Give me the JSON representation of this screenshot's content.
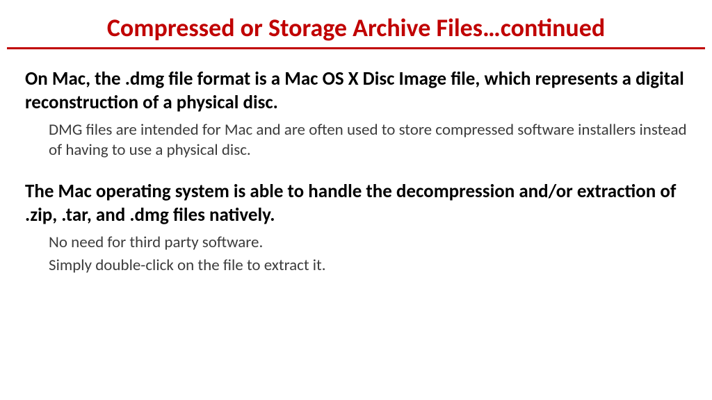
{
  "title": "Compressed or Storage Archive Files…continued",
  "blocks": [
    {
      "lead": "On Mac, the .dmg file format is a Mac OS X Disc Image file, which represents a digital reconstruction of a physical disc.",
      "subs": [
        "DMG files are intended for Mac and are often used to store compressed software installers instead of having to use a physical disc."
      ]
    },
    {
      "lead": "The Mac operating system is able to handle the decompression and/or extraction of .zip, .tar, and .dmg files natively.",
      "subs": [
        "No need for third party software.",
        "Simply double-click on the file to extract it."
      ]
    }
  ]
}
